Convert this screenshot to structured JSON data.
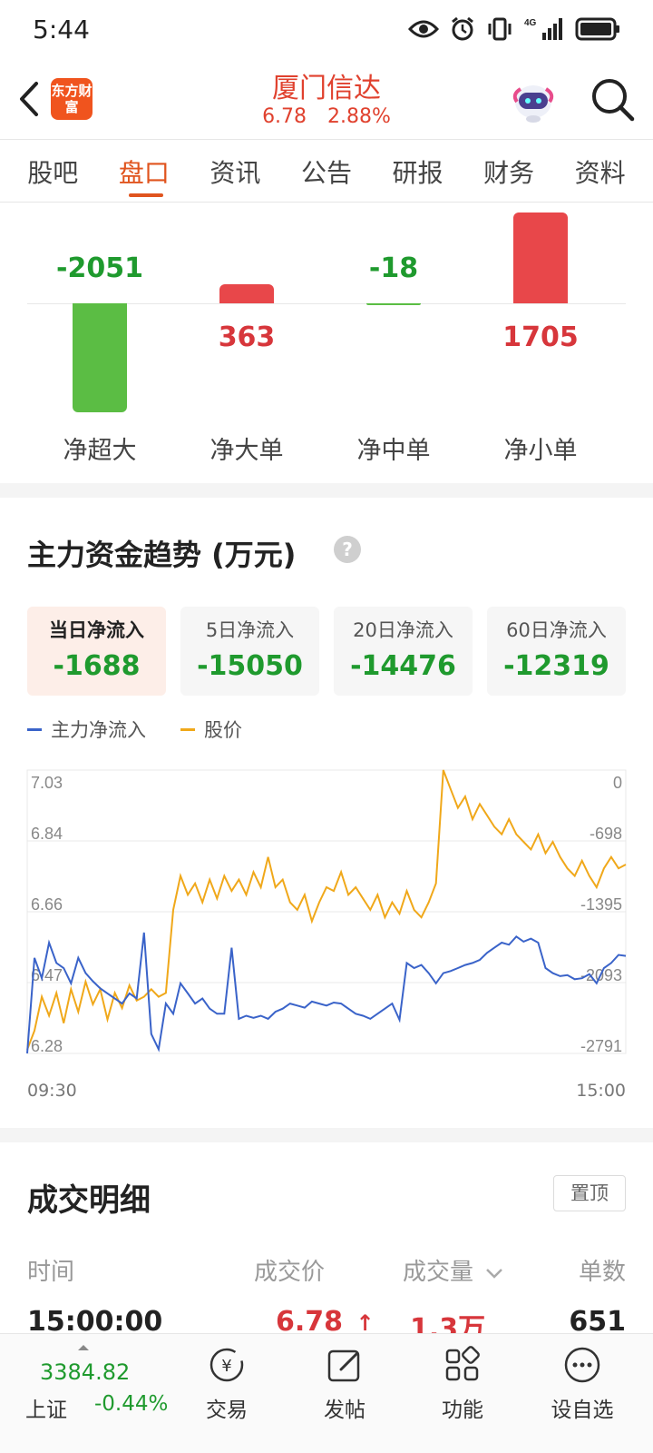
{
  "status_bar": {
    "time": "5:44",
    "icons": [
      "eye-icon",
      "alarm-icon",
      "vibrate-icon",
      "signal-4g-icon",
      "battery-icon"
    ],
    "network": "4G"
  },
  "header": {
    "brand_logo": "东方财富",
    "stock_name": "厦门信达",
    "price": "6.78",
    "change_pct": "2.88%",
    "accent_color": "#e0412e"
  },
  "tabs": [
    "股吧",
    "盘口",
    "资讯",
    "公告",
    "研报",
    "财务",
    "资料"
  ],
  "active_tab": "盘口",
  "net_flow": {
    "items": [
      {
        "label": "净超大",
        "value": "-2051",
        "num": -2051,
        "sign": "negative"
      },
      {
        "label": "净大单",
        "value": "363",
        "num": 363,
        "sign": "positive"
      },
      {
        "label": "净中单",
        "value": "-18",
        "num": -18,
        "sign": "negative"
      },
      {
        "label": "净小单",
        "value": "1705",
        "num": 1705,
        "sign": "positive"
      }
    ],
    "colors": {
      "positive": "#e8474a",
      "negative": "#5bbd44"
    }
  },
  "trend": {
    "title": "主力资金趋势 (万元)",
    "help_icon": "?",
    "periods": [
      {
        "label": "当日净流入",
        "value": "-1688"
      },
      {
        "label": "5日净流入",
        "value": "-15050"
      },
      {
        "label": "20日净流入",
        "value": "-14476"
      },
      {
        "label": "60日净流入",
        "value": "-12319"
      }
    ],
    "legend": [
      {
        "name": "主力净流入",
        "color": "#3a63c9"
      },
      {
        "name": "股价",
        "color": "#f0a81a"
      }
    ],
    "time_start": "09:30",
    "time_end": "15:00"
  },
  "chart_data": {
    "type": "line",
    "x_range": [
      "09:30",
      "15:00"
    ],
    "left_axis": {
      "ticks": [
        "7.03",
        "6.84",
        "6.66",
        "6.47",
        "6.28"
      ],
      "ylim": [
        6.28,
        7.03
      ]
    },
    "right_axis": {
      "ticks": [
        "0",
        "-698",
        "-1395",
        "-2093",
        "-2791"
      ],
      "ylim": [
        -2791,
        0
      ]
    },
    "series": [
      {
        "name": "股价",
        "axis": "left",
        "color": "#f0a81a",
        "values": [
          6.29,
          6.34,
          6.43,
          6.38,
          6.44,
          6.36,
          6.45,
          6.39,
          6.47,
          6.41,
          6.45,
          6.37,
          6.44,
          6.4,
          6.46,
          6.42,
          6.43,
          6.45,
          6.43,
          6.44,
          6.66,
          6.75,
          6.7,
          6.73,
          6.68,
          6.74,
          6.69,
          6.75,
          6.71,
          6.74,
          6.7,
          6.76,
          6.72,
          6.8,
          6.72,
          6.74,
          6.68,
          6.66,
          6.7,
          6.63,
          6.68,
          6.72,
          6.71,
          6.76,
          6.7,
          6.72,
          6.69,
          6.66,
          6.7,
          6.64,
          6.68,
          6.65,
          6.71,
          6.66,
          6.64,
          6.68,
          6.73,
          7.03,
          6.98,
          6.93,
          6.96,
          6.9,
          6.94,
          6.91,
          6.88,
          6.86,
          6.9,
          6.86,
          6.84,
          6.82,
          6.86,
          6.81,
          6.84,
          6.8,
          6.77,
          6.75,
          6.79,
          6.75,
          6.72,
          6.77,
          6.8,
          6.77,
          6.78
        ]
      },
      {
        "name": "主力净流入",
        "axis": "right",
        "color": "#3a63c9",
        "values": [
          -2790,
          -1850,
          -2050,
          -1700,
          -1900,
          -1950,
          -2100,
          -1850,
          -2000,
          -2080,
          -2150,
          -2200,
          -2250,
          -2300,
          -2200,
          -2250,
          -1600,
          -2600,
          -2750,
          -2300,
          -2400,
          -2100,
          -2200,
          -2300,
          -2250,
          -2350,
          -2400,
          -2400,
          -1750,
          -2450,
          -2420,
          -2440,
          -2420,
          -2450,
          -2380,
          -2350,
          -2300,
          -2320,
          -2340,
          -2280,
          -2300,
          -2320,
          -2290,
          -2300,
          -2350,
          -2400,
          -2420,
          -2450,
          -2400,
          -2350,
          -2300,
          -2460,
          -1900,
          -1950,
          -1920,
          -2000,
          -2100,
          -2000,
          -1980,
          -1950,
          -1920,
          -1900,
          -1870,
          -1800,
          -1750,
          -1700,
          -1720,
          -1640,
          -1690,
          -1660,
          -1700,
          -1950,
          -2000,
          -2030,
          -2020,
          -2060,
          -2050,
          -2010,
          -2100,
          -1950,
          -1900,
          -1820,
          -1830
        ]
      }
    ]
  },
  "trade_detail": {
    "title": "成交明细",
    "pin_label": "置顶",
    "columns": [
      "时间",
      "成交价",
      "成交量",
      "单数"
    ],
    "rows": [
      {
        "time": "15:00:00",
        "price": "6.78",
        "arrow": "↑",
        "volume": "1.3万",
        "count": "651"
      }
    ]
  },
  "bottom_bar": {
    "index_value": "3384.82",
    "index_name": "上证",
    "index_change": "-0.44%",
    "nav": [
      {
        "label": "交易",
        "icon": "trade-icon"
      },
      {
        "label": "发帖",
        "icon": "compose-icon"
      },
      {
        "label": "功能",
        "icon": "apps-grid-icon"
      },
      {
        "label": "设自选",
        "icon": "more-dots-icon"
      }
    ]
  }
}
